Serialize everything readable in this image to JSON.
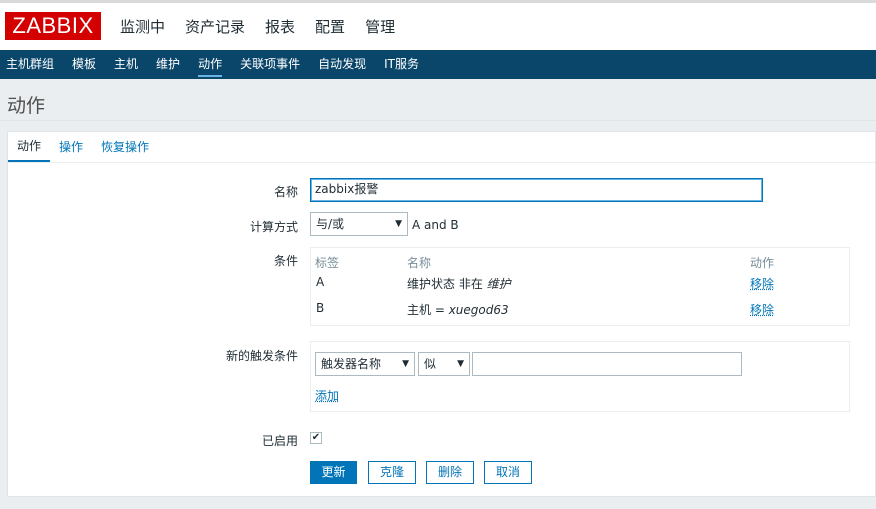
{
  "app": {
    "logo": "ZABBIX"
  },
  "main_menu": [
    "监测中",
    "资产记录",
    "报表",
    "配置",
    "管理"
  ],
  "sub_menu": [
    "主机群组",
    "模板",
    "主机",
    "维护",
    "动作",
    "关联项事件",
    "自动发现",
    "IT服务"
  ],
  "page": {
    "title": "动作"
  },
  "tabs": [
    "动作",
    "操作",
    "恢复操作"
  ],
  "form": {
    "name_label": "名称",
    "name_value": "zabbix报警",
    "calc_label": "计算方式",
    "calc_value": "与/或",
    "calc_expr": "A and B",
    "cond_label": "条件",
    "cond_headers": {
      "label": "标签",
      "name": "名称",
      "action": "动作"
    },
    "conditions": [
      {
        "label": "A",
        "name_prefix": "维护状态 非在 ",
        "name_value": "维护",
        "action": "移除"
      },
      {
        "label": "B",
        "name_prefix": "主机 = ",
        "name_value": "xuegod63",
        "action": "移除"
      }
    ],
    "new_cond_label": "新的触发条件",
    "new_cond_type": "触发器名称",
    "new_cond_op": "似",
    "new_cond_value": "",
    "add_link": "添加",
    "enabled_label": "已启用",
    "enabled_mark": "✔"
  },
  "buttons": {
    "update": "更新",
    "clone": "克隆",
    "delete": "删除",
    "cancel": "取消"
  },
  "colors": {
    "brand": "#d40000",
    "nav": "#0a466a",
    "accent": "#0275b8"
  }
}
